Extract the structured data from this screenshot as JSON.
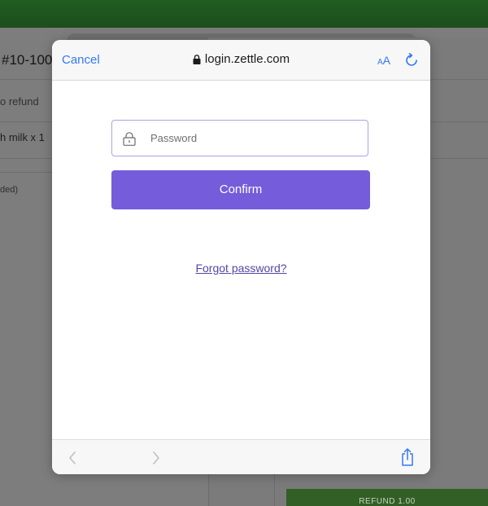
{
  "background_app": {
    "order_number": "#10-100",
    "no_refund_text": "o refund",
    "item_text": "h milk  x 1",
    "refunded_text": "ded)",
    "refund_button_label": "REFUND 1.00"
  },
  "browser": {
    "cancel_label": "Cancel",
    "url": "login.zettle.com",
    "text_size_small": "A",
    "text_size_large": "A"
  },
  "form": {
    "password_placeholder": "Password",
    "confirm_label": "Confirm",
    "forgot_password_label": "Forgot password?"
  },
  "icons": {
    "lock": "lock-icon",
    "password_lock": "lock-icon",
    "reload": "reload-icon",
    "back": "chevron-left-icon",
    "forward": "chevron-right-icon",
    "share": "share-icon"
  },
  "colors": {
    "accent_blue": "#3478f6",
    "confirm_purple": "#745cdb",
    "link_purple": "#5546a8",
    "header_green": "#215d21"
  }
}
